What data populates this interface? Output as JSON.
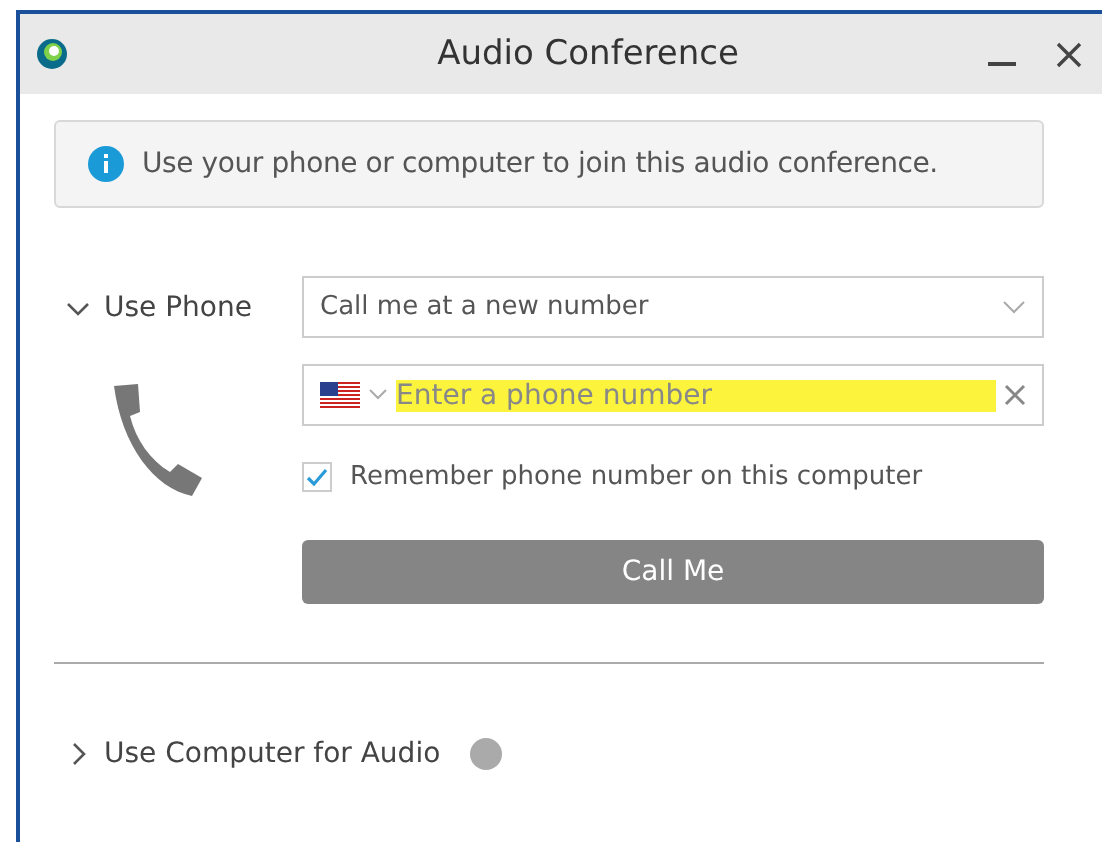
{
  "window": {
    "title": "Audio Conference"
  },
  "info": "Use your phone or computer to join this audio conference.",
  "sections": [
    {
      "kind": "phone",
      "label": "Use Phone",
      "expanded": true,
      "call_option": "Call me at a new number",
      "phone_field": {
        "placeholder": "Enter a phone number",
        "highlighted": true
      },
      "remember": {
        "label": "Remember phone number on this computer",
        "checked": true
      },
      "button": "Call Me"
    },
    {
      "kind": "computer",
      "label": "Use Computer for Audio",
      "expanded": false
    }
  ]
}
